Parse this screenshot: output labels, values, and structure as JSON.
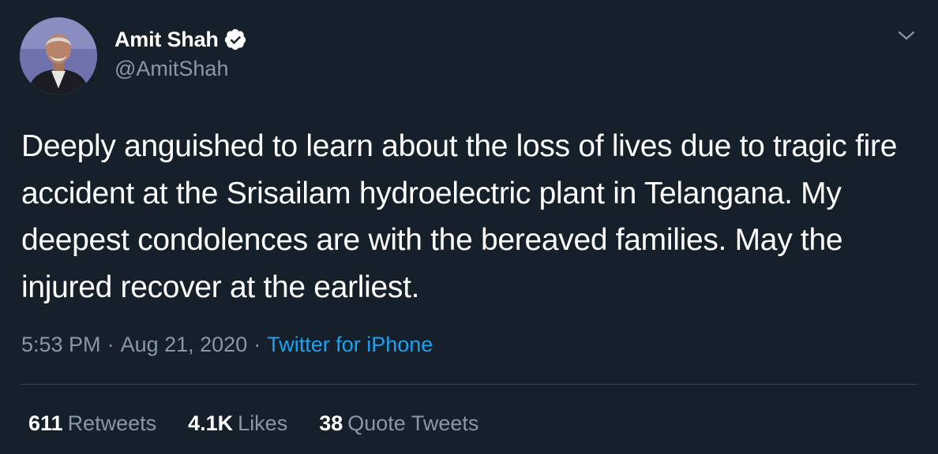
{
  "author": {
    "display_name": "Amit Shah",
    "handle": "@AmitShah",
    "verified": true
  },
  "tweet": {
    "text": "Deeply anguished to learn about the loss of lives due to tragic fire accident at the Srisailam hydroelectric plant in Telangana. My deepest condolences are with the bereaved families. May the injured recover at the earliest.",
    "time": "5:53 PM",
    "date": "Aug 21, 2020",
    "separator": "·",
    "source": "Twitter for iPhone"
  },
  "stats": {
    "retweets_count": "611",
    "retweets_label": "Retweets",
    "likes_count": "4.1K",
    "likes_label": "Likes",
    "quotes_count": "38",
    "quotes_label": "Quote Tweets"
  },
  "icons": {
    "verified": "verified-badge-icon",
    "menu": "chevron-down-icon"
  },
  "colors": {
    "background": "#15202b",
    "text": "#ffffff",
    "secondary": "#8899a6",
    "accent": "#1da1f2",
    "divider": "#38444d"
  }
}
